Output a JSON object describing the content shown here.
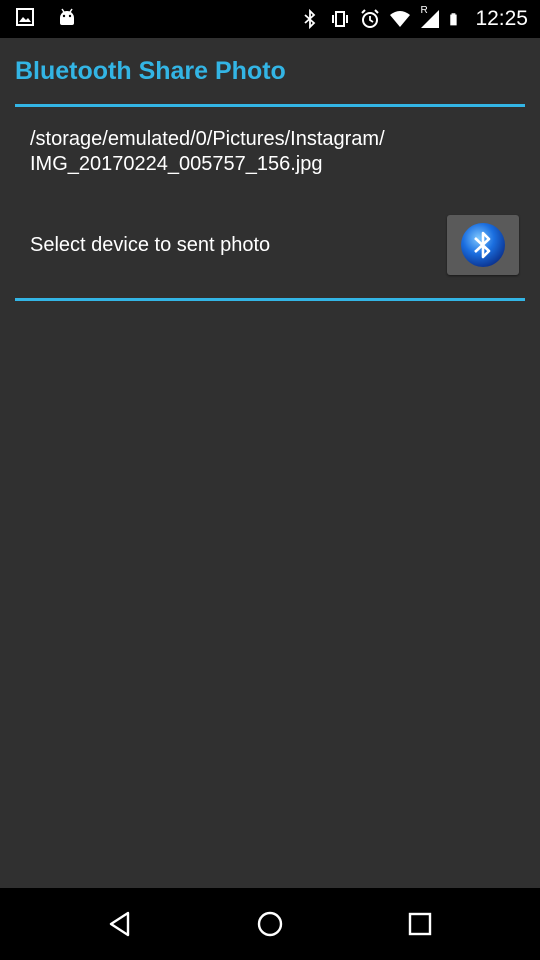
{
  "status_bar": {
    "time": "12:25",
    "left_icons": [
      "image-notification-icon",
      "android-notification-icon"
    ],
    "right_icons": [
      "bluetooth-icon",
      "vibrate-icon",
      "alarm-icon",
      "wifi-icon",
      "signal-roaming-icon",
      "battery-icon"
    ],
    "roaming_indicator": "R"
  },
  "app": {
    "title": "Bluetooth Share Photo",
    "accent_color": "#33b5e5",
    "background_color": "#303030"
  },
  "content": {
    "file_path": "/storage/emulated/0/Pictures/Instagram/\nIMG_20170224_005757_156.jpg",
    "select_label": "Select device to sent photo",
    "bluetooth_button_icon": "bluetooth-icon"
  },
  "nav_bar": {
    "buttons": [
      "back-icon",
      "home-icon",
      "recents-icon"
    ]
  }
}
